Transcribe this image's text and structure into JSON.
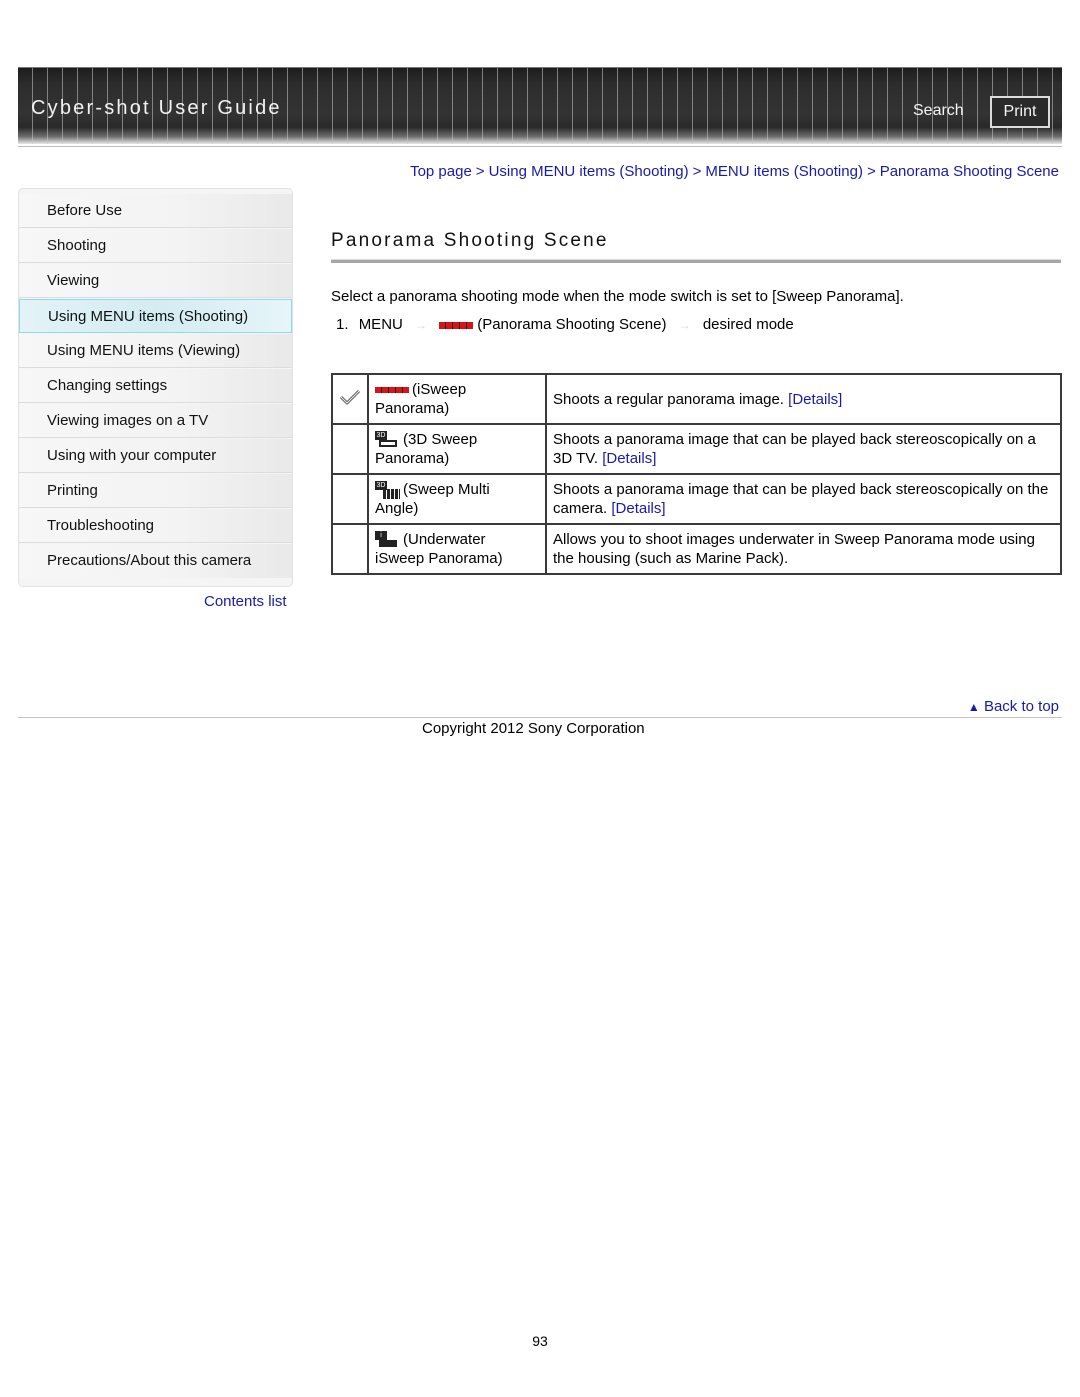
{
  "header": {
    "title": "Cyber-shot User Guide",
    "search_label": "Search",
    "print_label": "Print"
  },
  "breadcrumb": [
    {
      "label": "Top page"
    },
    {
      "label": "Using MENU items (Shooting)"
    },
    {
      "label": "MENU items (Shooting)"
    },
    {
      "label": "Panorama Shooting Scene"
    }
  ],
  "breadcrumb_sep": ">",
  "sidebar": {
    "items": [
      {
        "label": "Before Use"
      },
      {
        "label": "Shooting"
      },
      {
        "label": "Viewing"
      },
      {
        "label": "Using MENU items (Shooting)",
        "active": true
      },
      {
        "label": "Using MENU items (Viewing)"
      },
      {
        "label": "Changing settings"
      },
      {
        "label": "Viewing images on a TV"
      },
      {
        "label": "Using with your computer"
      },
      {
        "label": "Printing"
      },
      {
        "label": "Troubleshooting"
      },
      {
        "label": "Precautions/About this camera"
      }
    ],
    "contents_link": "Contents list"
  },
  "main": {
    "title": "Panorama Shooting Scene",
    "intro": "Select a panorama shooting mode when the mode switch is set to [Sweep Panorama].",
    "step": {
      "number": "1.",
      "menu": "MENU",
      "arrow": "→",
      "item": "(Panorama Shooting Scene)",
      "target": "desired mode"
    },
    "modes": [
      {
        "default": true,
        "icon": "iSweep-panorama-icon",
        "name_line1": "(iSweep",
        "name_line2": "Panorama)",
        "desc": "Shoots a regular panorama image.",
        "link": "[Details]"
      },
      {
        "default": false,
        "icon": "3d-sweep-panorama-icon",
        "name_line1": "(3D Sweep",
        "name_line2": "Panorama)",
        "desc": "Shoots a panorama image that can be played back stereoscopically on a 3D TV.",
        "link": "[Details]"
      },
      {
        "default": false,
        "icon": "sweep-multi-angle-icon",
        "name_line1": "(Sweep Multi",
        "name_line2": "Angle)",
        "desc": "Shoots a panorama image that can be played back stereoscopically on the camera.",
        "link": "[Details]"
      },
      {
        "default": false,
        "icon": "underwater-sweep-icon",
        "name_line1": "(Underwater",
        "name_line2": "iSweep Panorama)",
        "desc": "Allows you to shoot images underwater in Sweep Panorama mode using the housing (such as Marine Pack).",
        "link": ""
      }
    ]
  },
  "footer": {
    "back_to_top": "Back to top",
    "copyright": "Copyright 2012 Sony Corporation",
    "page_number": "93"
  },
  "colors": {
    "link": "#1a1aa6",
    "active_nav": "#d3ecf2",
    "pano_icon_red": "#d91414"
  }
}
